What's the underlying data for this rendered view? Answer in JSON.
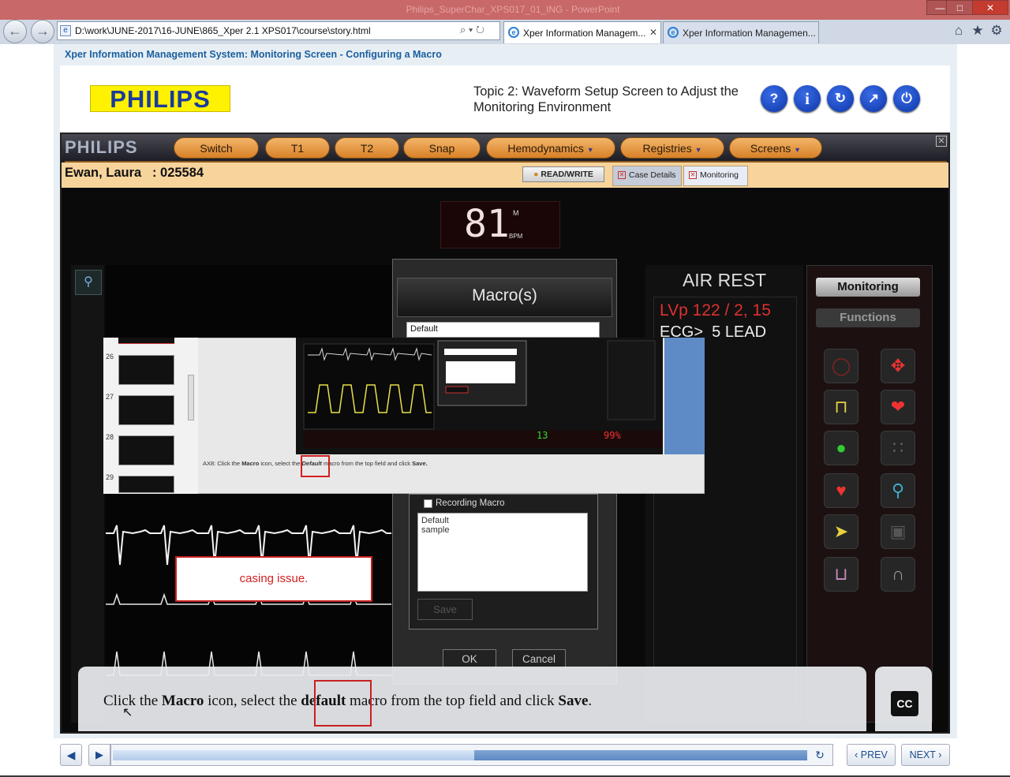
{
  "browser": {
    "window_title": "Philips_SuperChar_XPS017_01_ING - PowerPoint",
    "address": "D:\\work\\JUNE-2017\\16-JUNE\\865_Xper 2.1 XPS017\\course\\story.html",
    "tabs": [
      {
        "label": "Xper Information Managem...",
        "active": true
      },
      {
        "label": "Xper Information Managemen...",
        "active": false
      }
    ],
    "window_buttons": {
      "minimize": "—",
      "maximize": "□",
      "close": "✕"
    },
    "icons": {
      "back": "←",
      "forward": "→",
      "home": "⌂",
      "favorites": "★",
      "settings": "⚙",
      "search": "⌕",
      "refresh": "↻"
    }
  },
  "course": {
    "title": "Xper Information Management System: Monitoring Screen - Configuring a Macro",
    "logo": "PHILIPS",
    "topic": "Topic 2: Waveform Setup Screen to Adjust the Monitoring Environment",
    "header_buttons": [
      {
        "name": "help",
        "glyph": "?"
      },
      {
        "name": "info",
        "glyph": "i"
      },
      {
        "name": "restart",
        "glyph": "↻"
      },
      {
        "name": "navigate",
        "glyph": "↗"
      },
      {
        "name": "exit",
        "glyph": "⏻"
      }
    ]
  },
  "xper": {
    "logo": "PHILIPS",
    "nav": [
      {
        "label": "Switch",
        "dropdown": false
      },
      {
        "label": "T1",
        "dropdown": false
      },
      {
        "label": "T2",
        "dropdown": false
      },
      {
        "label": "Snap",
        "dropdown": false
      },
      {
        "label": "Hemodynamics",
        "dropdown": true
      },
      {
        "label": "Registries",
        "dropdown": true
      },
      {
        "label": "Screens",
        "dropdown": true
      }
    ],
    "patient": "Ewan, Laura   : 025584",
    "read_write": "READ/WRITE",
    "tabs": [
      "Case Details",
      "Monitoring"
    ],
    "heart_rate": {
      "value": "81",
      "unit_top": "M",
      "unit": "BPM"
    },
    "macro_dialog": {
      "title": "Macro(s)",
      "top_field": "Default",
      "recording_label": "Recording Macro",
      "list": [
        "Default",
        "sample"
      ],
      "save": "Save",
      "ok": "OK",
      "cancel": "Cancel"
    },
    "monitor": {
      "condition": "AIR REST",
      "lvp": "LVp 122 / 2, 15",
      "ecg": "ECG>  5 LEAD"
    },
    "tool_panel": {
      "monitoring": "Monitoring",
      "functions": "Functions"
    }
  },
  "embedded_screenshot": {
    "slide_numbers": [
      "26",
      "27",
      "28",
      "29"
    ],
    "caption_prefix": "AX8: Click the ",
    "caption_macro": "Macro",
    "caption_mid": " icon, select the ",
    "caption_default": "Default",
    "caption_end": " macro from the top field and click ",
    "caption_save": "Save."
  },
  "review_note": "casing issue.",
  "caption": {
    "part1": "Click the ",
    "macro": "Macro",
    "part2": " icon, select the ",
    "default": "default",
    "part3": " macro from the top field and click ",
    "save": "Save",
    "end": "."
  },
  "cc_label": "CC",
  "player": {
    "progress": 0.52,
    "prev": "PREV",
    "next": "NEXT"
  }
}
